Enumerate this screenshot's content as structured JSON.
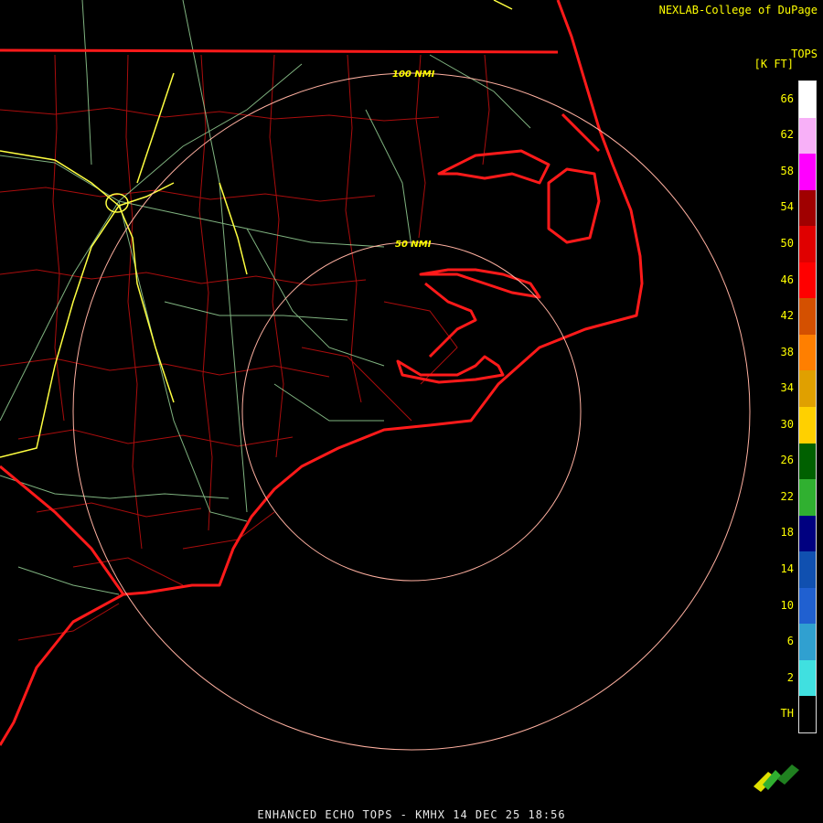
{
  "credit": "NEXLAB-College of DuPage",
  "footer": "ENHANCED ECHO TOPS - KMHX 14 DEC 25 18:56",
  "legend": {
    "title": "TOPS",
    "units": "[K FT]",
    "items": [
      {
        "label": "66",
        "color": "#ffffff"
      },
      {
        "label": "62",
        "color": "#f7b0f7"
      },
      {
        "label": "58",
        "color": "#ff00ff"
      },
      {
        "label": "54",
        "color": "#a00000"
      },
      {
        "label": "50",
        "color": "#e00000"
      },
      {
        "label": "46",
        "color": "#ff0000"
      },
      {
        "label": "42",
        "color": "#d45000"
      },
      {
        "label": "38",
        "color": "#ff7f00"
      },
      {
        "label": "34",
        "color": "#e0a000"
      },
      {
        "label": "30",
        "color": "#ffd000"
      },
      {
        "label": "26",
        "color": "#006000"
      },
      {
        "label": "22",
        "color": "#30b030"
      },
      {
        "label": "18",
        "color": "#000080"
      },
      {
        "label": "14",
        "color": "#1050b0"
      },
      {
        "label": "10",
        "color": "#2060d0"
      },
      {
        "label": "6",
        "color": "#30a0d0"
      },
      {
        "label": "2",
        "color": "#40e0e0"
      },
      {
        "label": "TH",
        "color": "#000000"
      }
    ]
  },
  "range_rings": [
    {
      "label": "50 NMI"
    },
    {
      "label": "100 NMI"
    }
  ],
  "colors": {
    "coast": "#ff1a1a",
    "county": "#d01010",
    "road": "#a0e0a0",
    "interstate": "#ffff40",
    "ring": "#ffb0a0"
  }
}
